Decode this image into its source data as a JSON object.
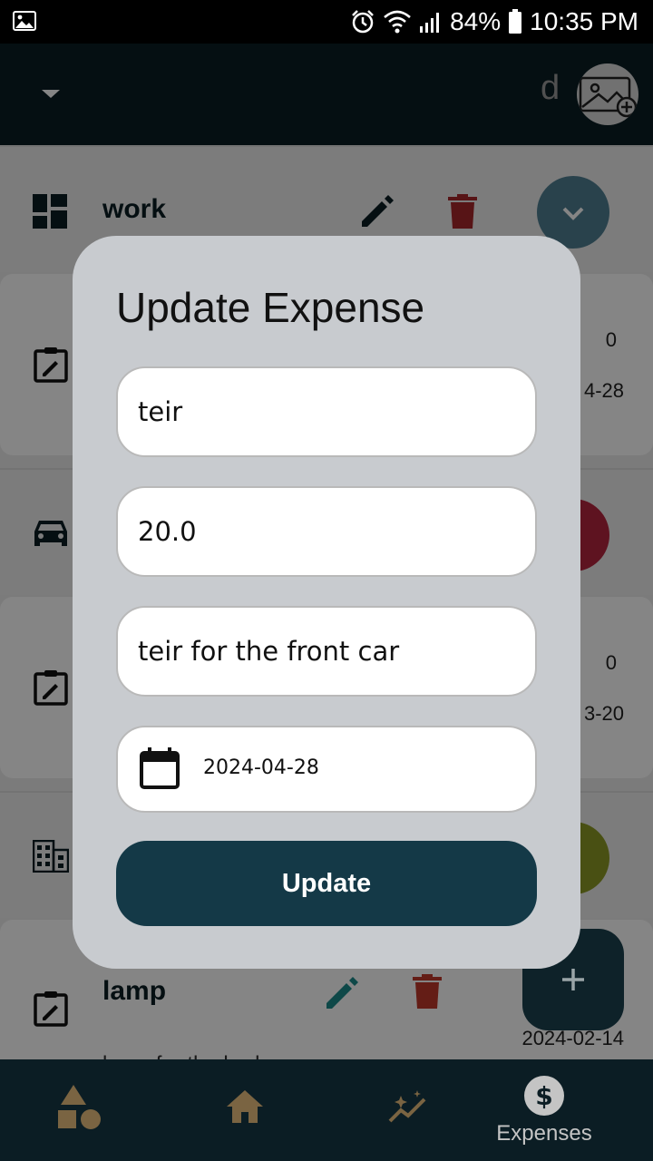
{
  "status_bar": {
    "battery": "84%",
    "time": "10:35 PM"
  },
  "app_bar": {
    "user_initial": "d"
  },
  "categories": [
    {
      "name": "work",
      "toggle_color": "#4f7f92"
    },
    {
      "name": "",
      "toggle_color": "#b5253f"
    },
    {
      "name": "",
      "toggle_color": "#8c9a25"
    }
  ],
  "expense_cards": [
    {
      "amount_fragment": "0",
      "date_fragment": "4-28"
    },
    {
      "amount_fragment": "0",
      "date_fragment": "3-20"
    }
  ],
  "lamp_item": {
    "name": "lamp",
    "date": "2024-02-14",
    "description": "lamp for the bedroom"
  },
  "dialog": {
    "title": "Update Expense",
    "name_value": "teir",
    "amount_value": "20.0",
    "description_value": "teir for the front car",
    "date_value": "2024-04-28",
    "update_label": "Update"
  },
  "bottom_nav": {
    "items": [
      {
        "icon": "shapes-icon",
        "label": ""
      },
      {
        "icon": "home-icon",
        "label": ""
      },
      {
        "icon": "insights-icon",
        "label": ""
      },
      {
        "icon": "dollar-icon",
        "label": "Expenses"
      }
    ]
  },
  "colors": {
    "app_bar": "#0b1d24",
    "accent": "#143947",
    "dialog_bg": "#c8cbcf",
    "nav_icon": "#c9a36a",
    "teal_edit": "#1b8a8a"
  }
}
